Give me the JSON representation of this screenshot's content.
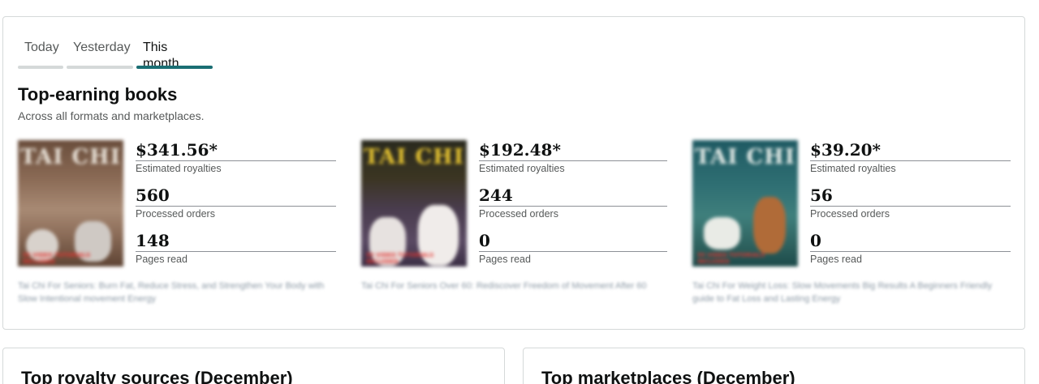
{
  "tabs": [
    {
      "label": "Today",
      "active": false
    },
    {
      "label": "Yesterday",
      "active": false
    },
    {
      "label": "This month",
      "active": true
    }
  ],
  "section": {
    "title": "Top-earning books",
    "subtitle": "Across all formats and marketplaces."
  },
  "books": [
    {
      "cover_title": "TAI CHI",
      "cover_tag": "55 VIDEO TUTORIALS INCLUDED",
      "royalties": "$341.56*",
      "royalties_label": "Estimated royalties",
      "orders": "560",
      "orders_label": "Processed orders",
      "pages": "148",
      "pages_label": "Pages read",
      "description": "Tai Chi For Seniors: Burn Fat, Reduce Stress, and Strengthen Your Body with Slow Intentional movement Energy"
    },
    {
      "cover_title": "TAI CHI",
      "cover_tag": "55 VIDEO TUTORIALS INCLUDED",
      "royalties": "$192.48*",
      "royalties_label": "Estimated royalties",
      "orders": "244",
      "orders_label": "Processed orders",
      "pages": "0",
      "pages_label": "Pages read",
      "description": "Tai Chi For Seniors Over 60: Rediscover Freedom of Movement After 60"
    },
    {
      "cover_title": "TAI CHI",
      "cover_tag": "55 VIDEO TUTORIALS INCLUDED",
      "royalties": "$39.20*",
      "royalties_label": "Estimated royalties",
      "orders": "56",
      "orders_label": "Processed orders",
      "pages": "0",
      "pages_label": "Pages read",
      "description": "Tai Chi For Weight Loss: Slow Movements Big Results A Beginners Friendly guide to Fat Loss and Lasting Energy"
    }
  ],
  "bottom": {
    "royalty_sources_title": "Top royalty sources (December)",
    "marketplaces_title": "Top marketplaces (December)"
  },
  "colors": {
    "active_tab": "#1a6e73",
    "inactive_tab_bar": "#d5d9d9",
    "border": "#d5d9d9"
  }
}
